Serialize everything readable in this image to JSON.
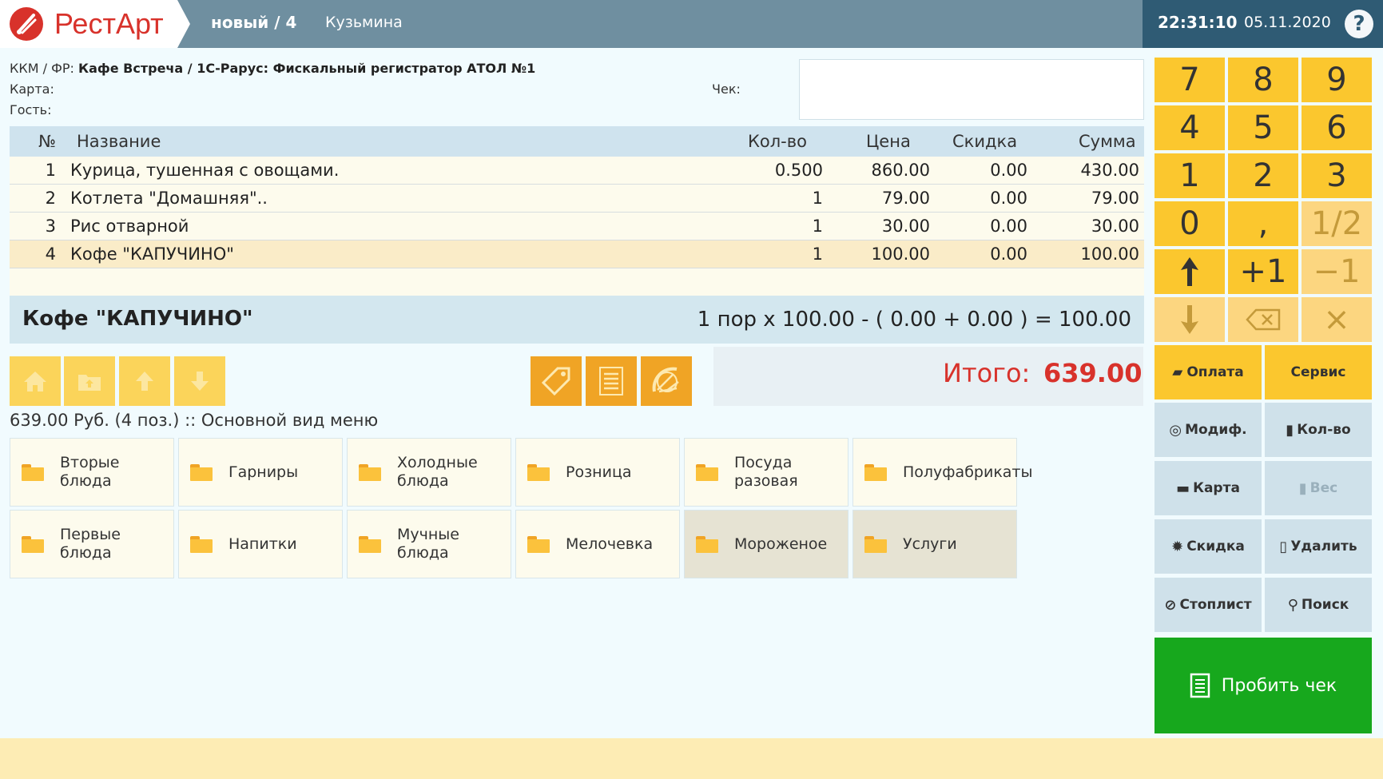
{
  "header": {
    "app_name": "РестАрт",
    "order": "новый / 4",
    "waiter": "Кузьмина",
    "time": "22:31:10",
    "date": "05.11.2020",
    "help": "?"
  },
  "info": {
    "kkm_label": "ККМ / ФР:",
    "kkm_value": "Кафе Встреча / 1С-Рарус: Фискальный регистратор АТОЛ №1",
    "card_label": "Карта:",
    "guest_label": "Гость:",
    "check_label": "Чек:"
  },
  "table": {
    "headers": {
      "no": "№",
      "name": "Название",
      "qty": "Кол-во",
      "price": "Цена",
      "discount": "Скидка",
      "sum": "Сумма"
    },
    "rows": [
      {
        "no": "1",
        "name": "Курица, тушенная с овощами.",
        "qty": "0.500",
        "price": "860.00",
        "discount": "0.00",
        "sum": "430.00"
      },
      {
        "no": "2",
        "name": "Котлета \"Домашняя\"..",
        "qty": "1",
        "price": "79.00",
        "discount": "0.00",
        "sum": "79.00"
      },
      {
        "no": "3",
        "name": "Рис отварной",
        "qty": "1",
        "price": "30.00",
        "discount": "0.00",
        "sum": "30.00"
      },
      {
        "no": "4",
        "name": "Кофе \"КАПУЧИНО\"",
        "qty": "1",
        "price": "100.00",
        "discount": "0.00",
        "sum": "100.00"
      }
    ]
  },
  "detail": {
    "name": "Кофе \"КАПУЧИНО\"",
    "formula": "1 пор x 100.00 - ( 0.00 + 0.00 ) = 100.00"
  },
  "totals": {
    "label": "Итого:",
    "value": "639.00"
  },
  "summary": "639.00 Руб. (4 поз.)  ::  Основной вид меню",
  "categories": [
    {
      "label": "Вторые блюда"
    },
    {
      "label": "Гарниры"
    },
    {
      "label": "Холодные блюда"
    },
    {
      "label": "Розница"
    },
    {
      "label": "Посуда разовая"
    },
    {
      "label": "Полуфабрикаты"
    },
    {
      "label": "Первые блюда"
    },
    {
      "label": "Напитки"
    },
    {
      "label": "Мучные блюда"
    },
    {
      "label": "Мелочевка"
    },
    {
      "label": "Мороженое"
    },
    {
      "label": "Услуги"
    }
  ],
  "keypad": {
    "k7": "7",
    "k8": "8",
    "k9": "9",
    "k4": "4",
    "k5": "5",
    "k6": "6",
    "k1": "1",
    "k2": "2",
    "k3": "3",
    "k0": "0",
    "comma": ",",
    "half": "1/2",
    "plus1": "+1",
    "minus1": "−1",
    "clear": "×"
  },
  "actions": {
    "payment": "Оплата",
    "service": "Сервис",
    "modifiers": "Модиф.",
    "quantity": "Кол-во",
    "card": "Карта",
    "weight": "Вес",
    "discount": "Скидка",
    "delete": "Удалить",
    "stoplist": "Стоплист",
    "search": "Поиск",
    "print_check": "Пробить чек"
  },
  "colors": {
    "header_bg": "#6f8fa0",
    "clock_bg": "#2f5b74",
    "brand_red": "#d8322b",
    "key_yellow": "#fbc72e",
    "print_green": "#17a81d"
  }
}
